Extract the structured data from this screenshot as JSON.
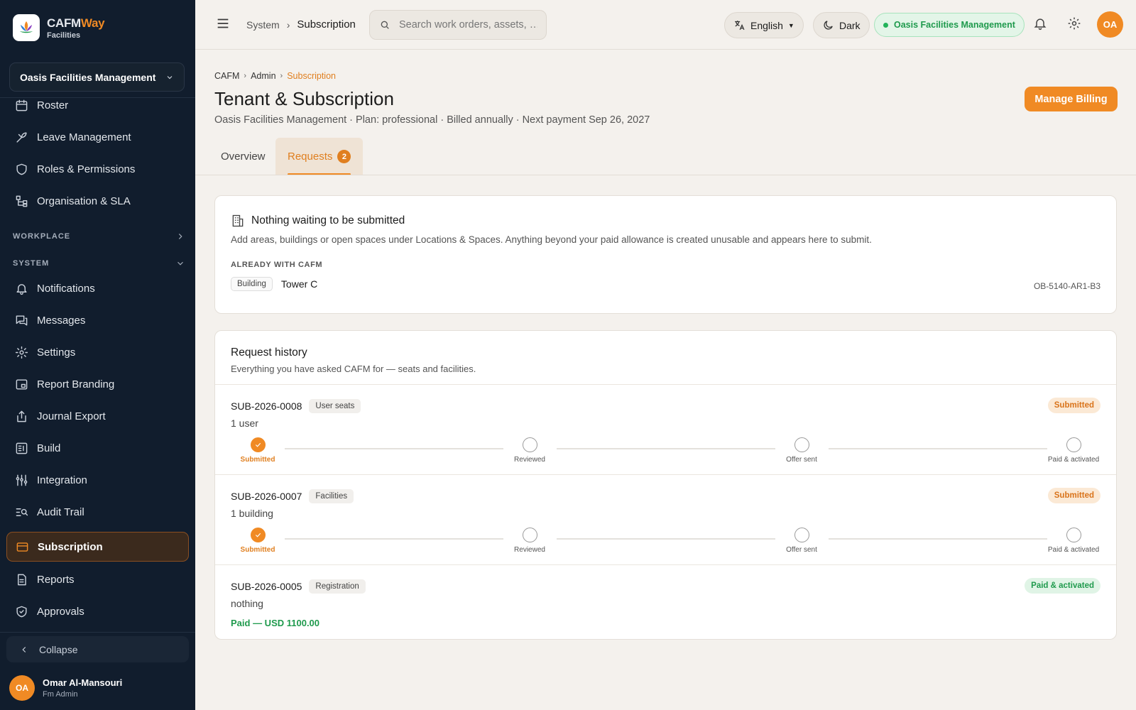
{
  "app": {
    "brand_name_main": "CAFM",
    "brand_name_accent": "Way",
    "brand_sub": "Facilities",
    "org_select": "Oasis Facilities Management"
  },
  "sidebar": {
    "items_top": [
      {
        "label": "Roster",
        "icon": "calendar-icon"
      },
      {
        "label": "Leave Management",
        "icon": "leave-icon"
      },
      {
        "label": "Roles & Permissions",
        "icon": "shield-icon"
      },
      {
        "label": "Organisation & SLA",
        "icon": "org-chart-icon"
      }
    ],
    "section_workplace": "WORKPLACE",
    "section_system": "SYSTEM",
    "items_system": [
      {
        "label": "Notifications",
        "icon": "bell-icon"
      },
      {
        "label": "Messages",
        "icon": "messages-icon"
      },
      {
        "label": "Settings",
        "icon": "gear-icon"
      },
      {
        "label": "Report Branding",
        "icon": "branding-icon"
      },
      {
        "label": "Journal Export",
        "icon": "export-icon"
      },
      {
        "label": "Build",
        "icon": "build-icon"
      },
      {
        "label": "Integration",
        "icon": "integration-icon"
      },
      {
        "label": "Audit Trail",
        "icon": "audit-icon"
      },
      {
        "label": "Subscription",
        "icon": "card-icon",
        "active": true
      },
      {
        "label": "Reports",
        "icon": "reports-icon"
      },
      {
        "label": "Approvals",
        "icon": "approvals-icon"
      }
    ],
    "collapse_label": "Collapse",
    "user": {
      "initials": "OA",
      "name": "Omar Al-Mansouri",
      "role": "Fm Admin"
    }
  },
  "topbar": {
    "crumb_parent": "System",
    "crumb_current": "Subscription",
    "search_placeholder": "Search work orders, assets, …",
    "language": "English",
    "theme": "Dark",
    "org_pill": "Oasis Facilities Management",
    "avatar_initials": "OA",
    "accent_color": "#f08a24"
  },
  "header": {
    "crumbs": [
      "CAFM",
      "Admin",
      "Subscription"
    ],
    "title": "Tenant & Subscription",
    "subtitle": "Oasis Facilities Management · Plan: professional · Billed annually · Next payment Sep 26, 2027",
    "manage_billing": "Manage Billing",
    "tabs": [
      {
        "label": "Overview"
      },
      {
        "label": "Requests",
        "badge": "2",
        "active": true
      }
    ]
  },
  "pending": {
    "title": "Nothing waiting to be submitted",
    "description": "Add areas, buildings or open spaces under Locations & Spaces. Anything beyond your paid allowance is created unusable and appears here to submit.",
    "already_label": "ALREADY WITH CAFM",
    "item": {
      "type": "Building",
      "name": "Tower C",
      "code": "OB-5140-AR1-B3"
    }
  },
  "history": {
    "title": "Request history",
    "subtitle": "Everything you have asked CAFM for — seats and facilities.",
    "steps": [
      "Submitted",
      "Reviewed",
      "Offer sent",
      "Paid & activated"
    ],
    "requests": [
      {
        "id": "SUB-2026-0008",
        "type": "User seats",
        "desc": "1 user",
        "status": "Submitted",
        "progress_steps_done": 1
      },
      {
        "id": "SUB-2026-0007",
        "type": "Facilities",
        "desc": "1 building",
        "status": "Submitted",
        "progress_steps_done": 1
      },
      {
        "id": "SUB-2026-0005",
        "type": "Registration",
        "desc": "nothing",
        "status": "Paid & activated",
        "paid_note": "Paid — USD 1100.00"
      }
    ]
  }
}
